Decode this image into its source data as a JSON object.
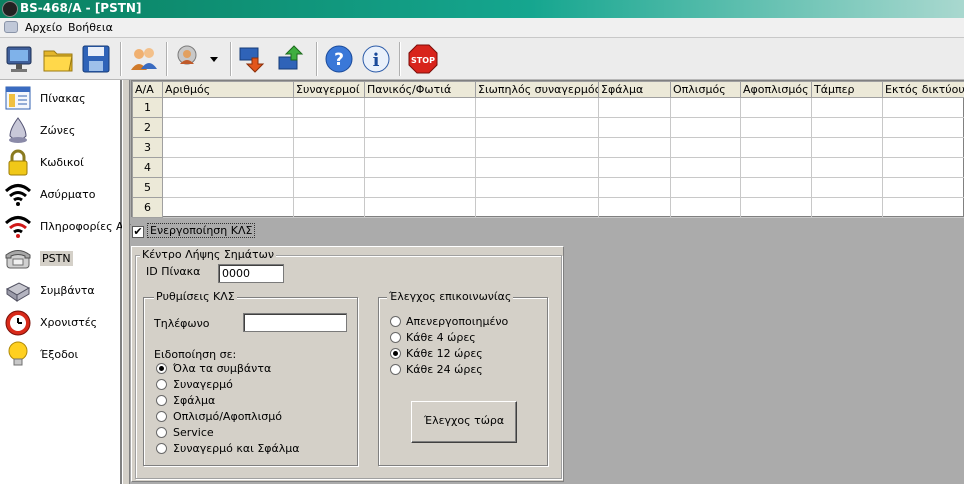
{
  "window": {
    "title": "BS-468/A - [PSTN]"
  },
  "menu": {
    "items": [
      "Αρχείο",
      "Βοήθεια"
    ]
  },
  "toolbar": {
    "icons": [
      "monitor-icon",
      "folder-icon",
      "save-icon",
      "users-icon",
      "user-settings-icon",
      "download-icon",
      "upload-icon",
      "help-icon",
      "info-icon",
      "stop-icon"
    ],
    "stop_label": "STOP",
    "help_glyph": "?",
    "info_glyph": "i"
  },
  "sidebar": {
    "items": [
      {
        "label": "Πίνακας",
        "icon": "panel-icon"
      },
      {
        "label": "Ζώνες",
        "icon": "zones-icon"
      },
      {
        "label": "Κωδικοί",
        "icon": "lock-icon"
      },
      {
        "label": "Ασύρματο",
        "icon": "wireless-icon"
      },
      {
        "label": "Πληροφορίες Ασ",
        "icon": "wireless-info-icon"
      },
      {
        "label": "PSTN",
        "icon": "phone-icon"
      },
      {
        "label": "Συμβάντα",
        "icon": "events-icon"
      },
      {
        "label": "Χρονιστές",
        "icon": "clock-icon"
      },
      {
        "label": "Έξοδοι",
        "icon": "bulb-icon"
      }
    ]
  },
  "grid": {
    "columns": [
      "Α/Α",
      "Αριθμός",
      "Συναγερμοί",
      "Πανικός/Φωτιά",
      "Σιωπηλός συναγερμός",
      "Σφάλμα",
      "Οπλισμός",
      "Αφοπλισμός",
      "Τάμπερ",
      "Εκτός δικτύου"
    ],
    "rows": [
      "1",
      "2",
      "3",
      "4",
      "5",
      "6"
    ]
  },
  "enable_checkbox": {
    "label": "Ενεργοποίηση ΚΛΣ",
    "checked": true,
    "mark": "✔"
  },
  "receiver": {
    "title": "Κέντρο Λήψης Σημάτων",
    "id_label": "ID Πίνακα",
    "id_value": "0000",
    "settings": {
      "title": "Ρυθμίσεις ΚΛΣ",
      "phone_label": "Τηλέφωνο",
      "phone_value": "",
      "notify_label": "Ειδοποίηση σε:",
      "options": [
        "Όλα τα συμβάντα",
        "Συναγερμό",
        "Σφάλμα",
        "Οπλισμό/Αφοπλισμό",
        "Service",
        "Συναγερμό και Σφάλμα"
      ],
      "selected": 0
    },
    "comm_check": {
      "title": "Έλεγχος επικοινωνίας",
      "options": [
        "Απενεργοποιημένο",
        "Κάθε 4 ώρες",
        "Κάθε 12 ώρες",
        "Κάθε 24 ώρες"
      ],
      "selected": 2,
      "button_label": "Έλεγχος τώρα"
    }
  }
}
